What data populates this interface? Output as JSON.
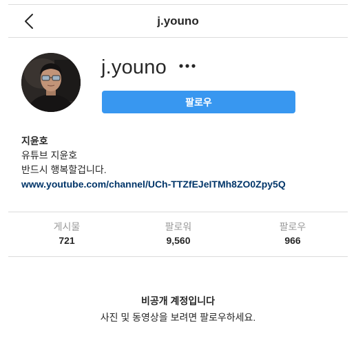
{
  "header": {
    "title": "j.youno",
    "back_icon": "chevron-left-icon"
  },
  "profile": {
    "username": "j.youno",
    "more_icon": "more-horizontal-icon",
    "follow_label": "팔로우",
    "follow_color": "#3897f0"
  },
  "bio": {
    "name": "지윤호",
    "line1": "유튜브 지윤호",
    "line2": "반드시 행복할겁니다.",
    "link": "www.youtube.com/channel/UCh-TTZfEJeITMh8ZO0Zpy5Q",
    "link_color": "#003569"
  },
  "stats": {
    "posts": {
      "label": "게시물",
      "value": "721"
    },
    "followers": {
      "label": "팔로워",
      "value": "9,560"
    },
    "following": {
      "label": "팔로우",
      "value": "966"
    }
  },
  "private_notice": {
    "title": "비공개 계정입니다",
    "description": "사진 및 동영상을 보려면 팔로우하세요."
  }
}
